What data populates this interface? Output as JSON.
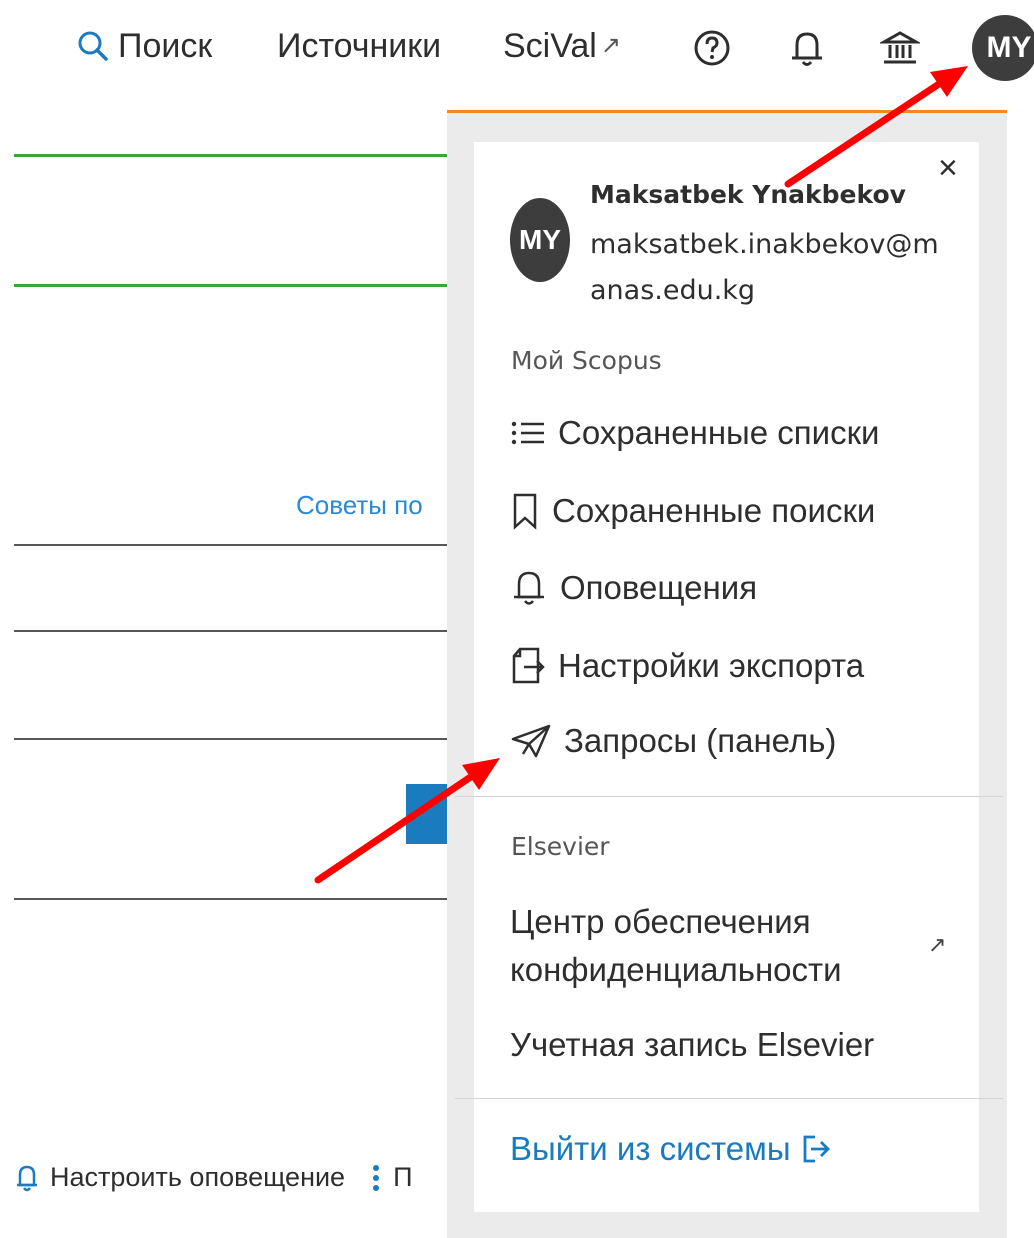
{
  "nav": {
    "search_label": "Поиск",
    "sources_label": "Источники",
    "scival_label": "SciVal",
    "scival_ext": "↗",
    "avatar_initials": "MY"
  },
  "page": {
    "tips_link": "Советы по",
    "bottom_alert": "Настроить оповещение",
    "bottom_more": "П"
  },
  "dropdown": {
    "close": "×",
    "avatar_initials": "MY",
    "user_name": "Maksatbek Ynakbekov",
    "user_email": "maksatbek.inakbekov@manas.edu.kg",
    "my_scopus_title": "Мой Scopus",
    "items": [
      {
        "label": "Сохраненные списки",
        "icon": "list-icon"
      },
      {
        "label": "Сохраненные поиски",
        "icon": "bookmark-icon"
      },
      {
        "label": "Оповещения",
        "icon": "bell-icon"
      },
      {
        "label": "Настройки экспорта",
        "icon": "export-icon"
      },
      {
        "label": "Запросы (панель)",
        "icon": "send-icon"
      }
    ],
    "elsevier_title": "Elsevier",
    "privacy_label": "Центр обеспечения конфиденциальности",
    "privacy_ext": "↗",
    "account_label": "Учетная запись Elsevier",
    "logout_label": "Выйти из системы"
  },
  "colors": {
    "accent_blue": "#1b7bbf",
    "orange_border": "#f08a24",
    "annotation_red": "#ff0000",
    "avatar_dark": "#3d3d3d"
  }
}
